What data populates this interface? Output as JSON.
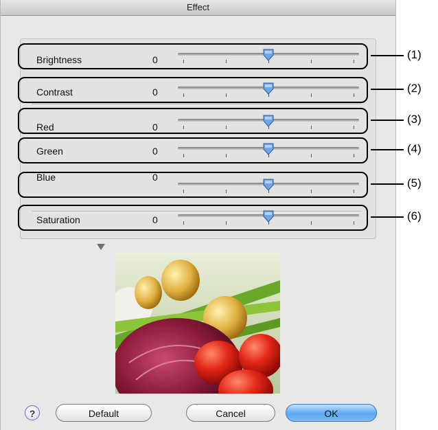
{
  "window": {
    "title": "Effect"
  },
  "sliders": [
    {
      "label": "Brightness",
      "value": "0",
      "callout": "(1)",
      "position": 0.5
    },
    {
      "label": "Contrast",
      "value": "0",
      "callout": "(2)",
      "position": 0.5
    },
    {
      "label": "Red",
      "value": "0",
      "callout": "(3)",
      "position": 0.5
    },
    {
      "label": "Green",
      "value": "0",
      "callout": "(4)",
      "position": 0.5
    },
    {
      "label": "Blue",
      "value": "0",
      "callout": "(5)",
      "position": 0.5
    },
    {
      "label": "Saturation",
      "value": "0",
      "callout": "(6)",
      "position": 0.5
    }
  ],
  "preview": {
    "icon": "vegetables-preview-image"
  },
  "buttons": {
    "help": "?",
    "default": "Default",
    "cancel": "Cancel",
    "ok": "OK"
  },
  "colors": {
    "ok_button": "#5aa7ee",
    "thumb": "#6fa6e6"
  }
}
